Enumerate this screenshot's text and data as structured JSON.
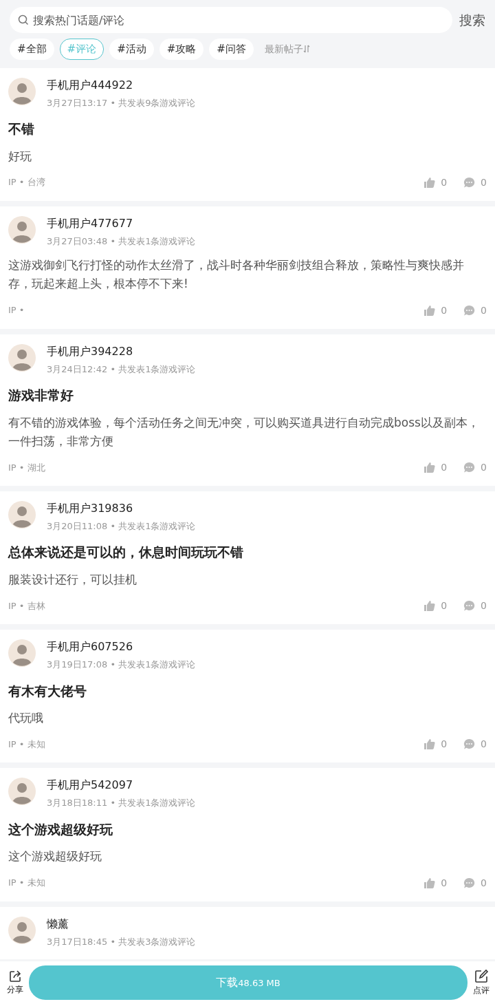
{
  "search": {
    "placeholder": "搜索热门话题/评论",
    "button": "搜索"
  },
  "tags": [
    {
      "label": "#全部",
      "selected": false
    },
    {
      "label": "#评论",
      "selected": true
    },
    {
      "label": "#活动",
      "selected": false
    },
    {
      "label": "#攻略",
      "selected": false
    },
    {
      "label": "#问答",
      "selected": false
    }
  ],
  "sort": {
    "label": "最新帖子"
  },
  "posts": [
    {
      "user": "手机用户444922",
      "meta": "3月27日13:17 • 共发表9条游戏评论",
      "title": "不错",
      "body": "好玩",
      "ip": "IP • 台湾",
      "likes": "0",
      "comments": "0"
    },
    {
      "user": "手机用户477677",
      "meta": "3月27日03:48 • 共发表1条游戏评论",
      "body": "这游戏御剑飞行打怪的动作太丝滑了，战斗时各种华丽剑技组合释放，策略性与爽快感并存，玩起来超上头，根本停不下来!",
      "ip": "IP •",
      "likes": "0",
      "comments": "0"
    },
    {
      "user": "手机用户394228",
      "meta": "3月24日12:42 • 共发表1条游戏评论",
      "title": "游戏非常好",
      "body": "有不错的游戏体验，每个活动任务之间无冲突，可以购买道具进行自动完成boss以及副本，一件扫荡，非常方便",
      "ip": "IP • 湖北",
      "likes": "0",
      "comments": "0"
    },
    {
      "user": "手机用户319836",
      "meta": "3月20日11:08 • 共发表1条游戏评论",
      "title": "总体来说还是可以的，休息时间玩玩不错",
      "body": "服装设计还行，可以挂机",
      "ip": "IP • 吉林",
      "likes": "0",
      "comments": "0"
    },
    {
      "user": "手机用户607526",
      "meta": "3月19日17:08 • 共发表1条游戏评论",
      "title": "有木有大佬号",
      "body": "代玩哦",
      "ip": "IP • 未知",
      "likes": "0",
      "comments": "0"
    },
    {
      "user": "手机用户542097",
      "meta": "3月18日18:11 • 共发表1条游戏评论",
      "title": "这个游戏超级好玩",
      "body": "这个游戏超级好玩",
      "ip": "IP • 未知",
      "likes": "0",
      "comments": "0"
    },
    {
      "user": "懒薰",
      "meta": "3月17日18:45 • 共发表3条游戏评论"
    }
  ],
  "bottom_bar": {
    "share": "分享",
    "download": "下载",
    "size": "48.63 MB",
    "review": "点评"
  }
}
